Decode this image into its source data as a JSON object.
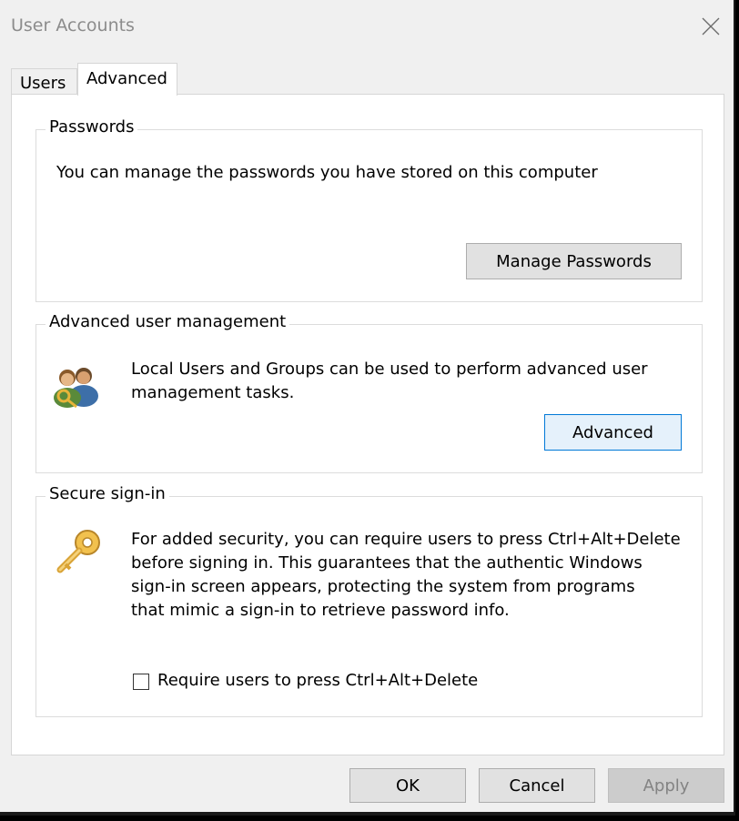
{
  "window": {
    "title": "User Accounts",
    "close_symbol": "✕"
  },
  "tabs": [
    {
      "label": "Users",
      "selected": false
    },
    {
      "label": "Advanced",
      "selected": true
    }
  ],
  "passwords": {
    "legend": "Passwords",
    "description": "You can manage the passwords you have stored on this computer",
    "button_label": "Manage Passwords"
  },
  "advanced_mgmt": {
    "legend": "Advanced user management",
    "description_line1": "Local Users and Groups can be used to perform advanced user",
    "description_line2": "management tasks.",
    "button_label": "Advanced",
    "icon": "users-group-icon"
  },
  "secure_signin": {
    "legend": "Secure sign-in",
    "description_lines": [
      "For added security, you can require users to press Ctrl+Alt+Delete",
      "before signing in. This guarantees that the authentic Windows",
      "sign-in screen appears, protecting the system from programs",
      "that mimic a sign-in to retrieve password info."
    ],
    "checkbox_label": "Require users to press Ctrl+Alt+Delete",
    "checkbox_checked": false,
    "icon": "key-icon"
  },
  "footer": {
    "ok_label": "OK",
    "cancel_label": "Cancel",
    "apply_label": "Apply",
    "apply_enabled": false
  },
  "colors": {
    "window_bg": "#f0f0f0",
    "panel_bg": "#ffffff",
    "focus_border": "#0078d7",
    "focus_bg": "#e5f1fb",
    "key_gold": "#e8b43a"
  }
}
